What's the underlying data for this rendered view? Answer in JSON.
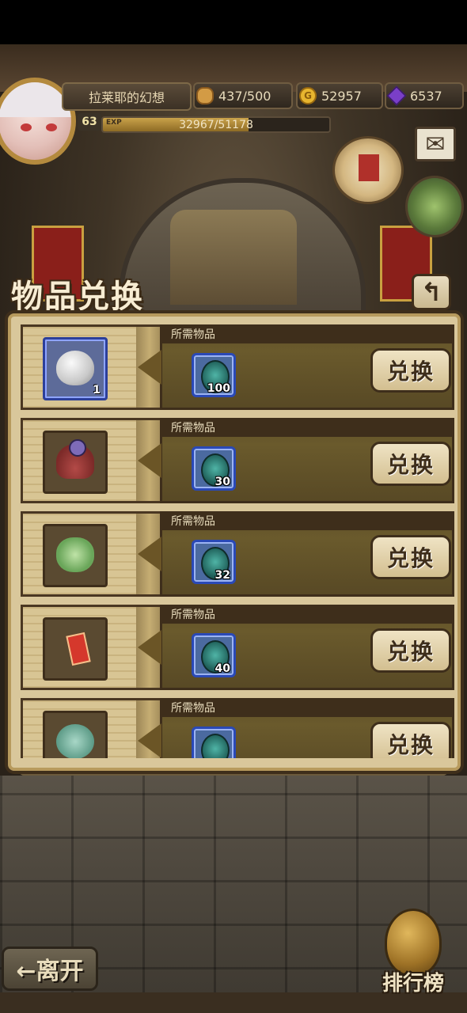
{
  "player": {
    "name": "拉莱耶的幻想",
    "level": "63",
    "exp_label": "EXP",
    "exp_text": "32967/51178",
    "exp_fraction": 0.644
  },
  "resources": {
    "stamina": "437/500",
    "gold": "52957",
    "gems": "6537"
  },
  "icons": {
    "bread": "bread-icon",
    "coin": "coin-icon",
    "gem": "gem-icon",
    "mail": "mail-icon",
    "quest": "scroll-icon",
    "bag": "backpack-icon",
    "back": "back-arrow-icon",
    "rank": "trophy-egg-icon"
  },
  "page": {
    "title": "物品兑换",
    "back_glyph": "↰"
  },
  "exchange": {
    "required_label": "所需物品",
    "button_label": "兑换",
    "rows": [
      {
        "item": "egg",
        "item_qty": "1",
        "cost": "100",
        "rare": true
      },
      {
        "item": "hat",
        "item_qty": "",
        "cost": "30",
        "rare": false
      },
      {
        "item": "vegetable",
        "item_qty": "",
        "cost": "32",
        "rare": false
      },
      {
        "item": "red-card",
        "item_qty": "",
        "cost": "40",
        "rare": false
      },
      {
        "item": "leaf",
        "item_qty": "",
        "cost": "",
        "rare": false
      }
    ]
  },
  "footer": {
    "leave_label": "←离开",
    "ranking_label": "排行榜"
  },
  "colors": {
    "panel": "#d9c79b",
    "bar": "#5f4f28",
    "frame": "#3e2e1b",
    "rare_border": "#2c3f9a"
  }
}
